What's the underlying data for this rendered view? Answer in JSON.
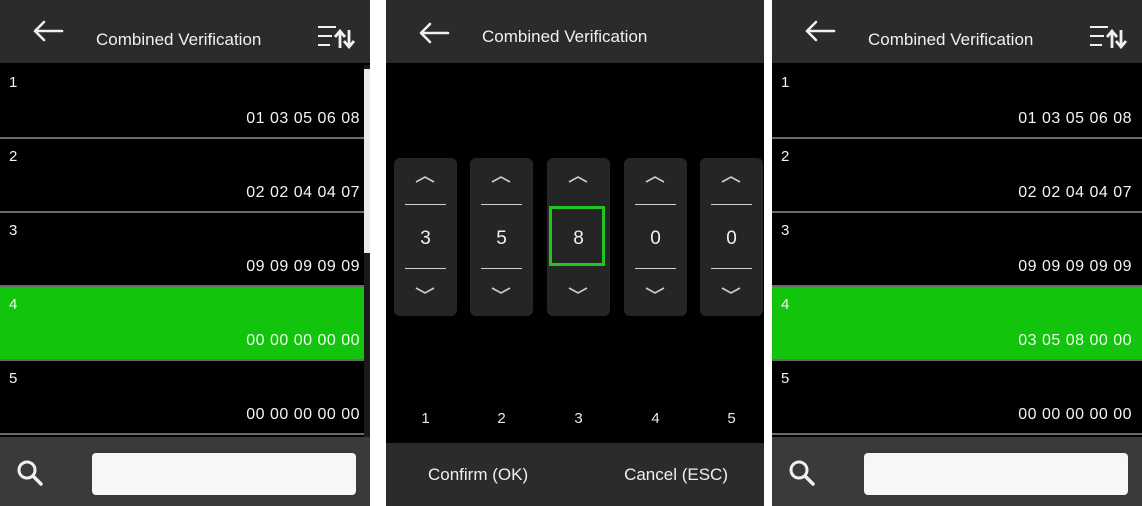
{
  "panel1": {
    "title": "Combined Verification",
    "rows": [
      {
        "index": "1",
        "value": "01 03 05 06 08",
        "selected": false
      },
      {
        "index": "2",
        "value": "02 02 04 04 07",
        "selected": false
      },
      {
        "index": "3",
        "value": "09 09 09 09 09",
        "selected": false
      },
      {
        "index": "4",
        "value": "00 00 00 00 00",
        "selected": true
      },
      {
        "index": "5",
        "value": "00 00 00 00 00",
        "selected": false
      }
    ],
    "search_value": ""
  },
  "panel2": {
    "title": "Combined Verification",
    "digits": [
      "3",
      "5",
      "8",
      "0",
      "0"
    ],
    "active_column": 3,
    "column_numbers": [
      "1",
      "2",
      "3",
      "4",
      "5"
    ],
    "confirm_label": "Confirm (OK)",
    "cancel_label": "Cancel (ESC)"
  },
  "panel3": {
    "title": "Combined Verification",
    "rows": [
      {
        "index": "1",
        "value": "01 03 05 06 08",
        "selected": false
      },
      {
        "index": "2",
        "value": "02 02 04 04 07",
        "selected": false
      },
      {
        "index": "3",
        "value": "09 09 09 09 09",
        "selected": false
      },
      {
        "index": "4",
        "value": "03 05 08 00 00",
        "selected": true
      },
      {
        "index": "5",
        "value": "00 00 00 00 00",
        "selected": false
      }
    ],
    "search_value": ""
  },
  "colors": {
    "selected_row": "#13c40c",
    "highlight_border": "#21c521",
    "header_bg": "#2b2b2b",
    "footer_bg": "#3a3a3a"
  },
  "icons": {
    "back": "back-arrow-icon",
    "sort": "sort-icon",
    "search": "search-icon",
    "increase": "chevron-up-icon",
    "decrease": "chevron-down-icon"
  }
}
